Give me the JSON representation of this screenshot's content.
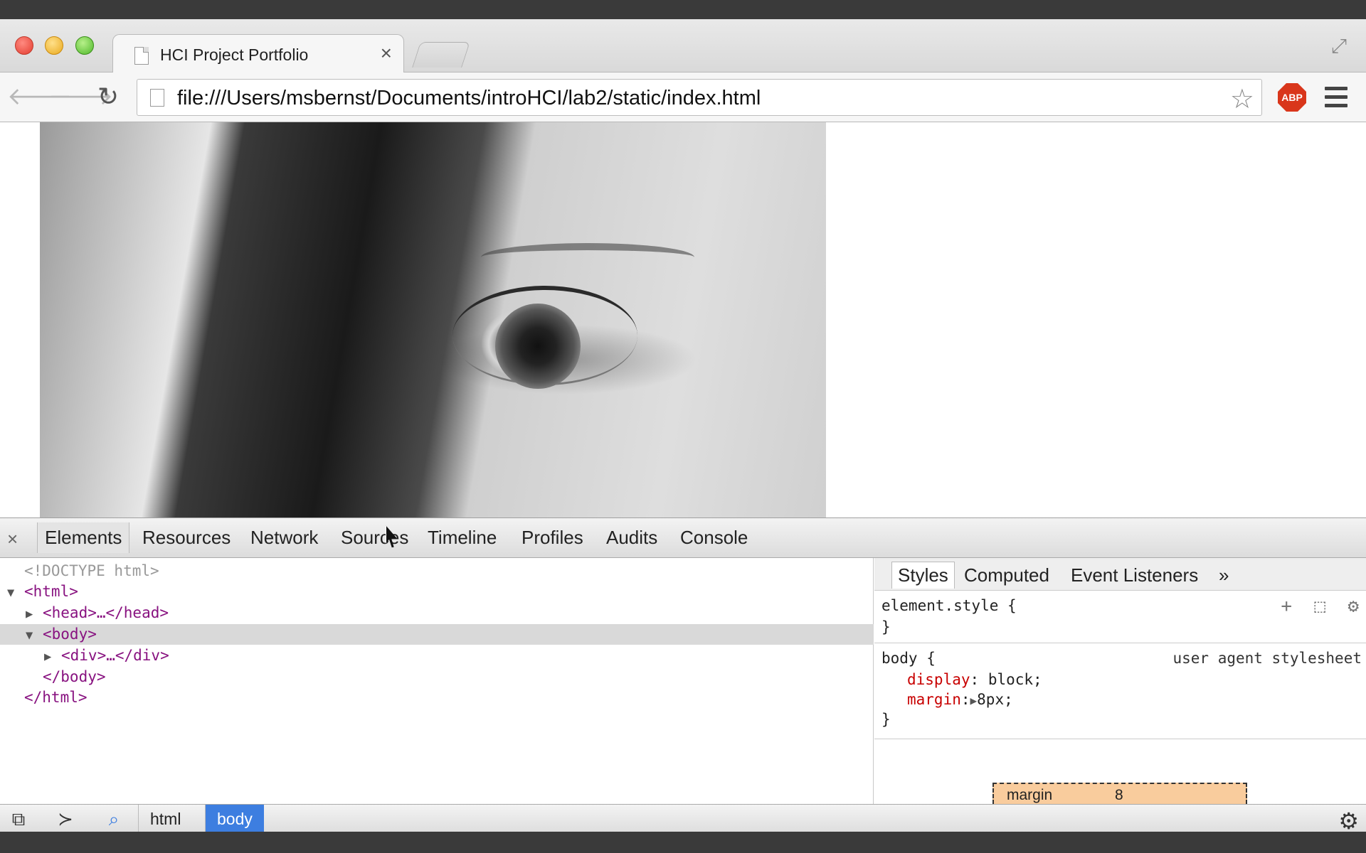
{
  "browser": {
    "tab_title": "HCI Project Portfolio",
    "tab_close": "×",
    "url": "file:///Users/msbernst/Documents/introHCI/lab2/static/index.html",
    "back_icon": "🡐",
    "forward_icon": "🡒",
    "reload_icon": "↻",
    "star_icon": "☆",
    "abp_label": "ABP",
    "fullscreen_icon": "⤢"
  },
  "devtools": {
    "close": "×",
    "tabs": [
      "Elements",
      "Resources",
      "Network",
      "Sources",
      "Timeline",
      "Profiles",
      "Audits",
      "Console"
    ],
    "active_tab": "Elements",
    "dom": {
      "doctype": "<!DOCTYPE html>",
      "html_open": "<html>",
      "head": "<head>…</head>",
      "body_open": "<body>",
      "div": "<div>…</div>",
      "body_close": "</body>",
      "html_close": "</html>"
    },
    "styles": {
      "tabs": [
        "Styles",
        "Computed",
        "Event Listeners",
        "»"
      ],
      "element_style_open": "element.style {",
      "close_brace": "}",
      "body_selector": "body {",
      "source": "user agent stylesheet",
      "props": [
        {
          "name": "display",
          "value": "block;"
        },
        {
          "name": "margin",
          "value": "8px;"
        }
      ],
      "box_model_label": "margin",
      "box_model_value": "8"
    },
    "breadcrumbs": [
      "html",
      "body"
    ],
    "active_crumb": "body"
  }
}
